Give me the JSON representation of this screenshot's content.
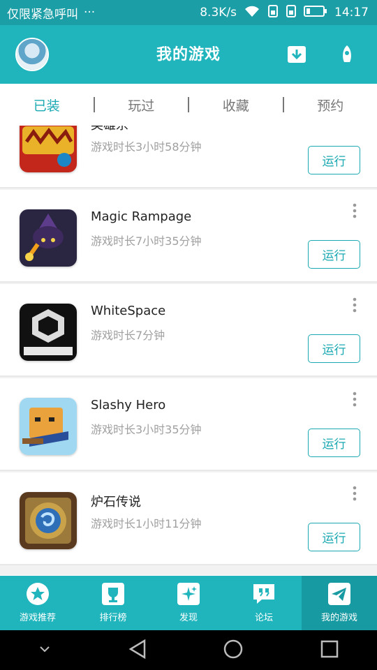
{
  "status_bar": {
    "carrier": "仅限紧急呼叫",
    "dots": "···",
    "speed": "8.3K/s",
    "time": "14:17"
  },
  "header": {
    "title": "我的游戏"
  },
  "tabs": [
    {
      "label": "已装",
      "active": true
    },
    {
      "label": "玩过",
      "active": false
    },
    {
      "label": "收藏",
      "active": false
    },
    {
      "label": "预约",
      "active": false
    }
  ],
  "games": [
    {
      "name": "英雄杀",
      "time": "游戏时长3小时58分钟",
      "button": "运行",
      "icon": "heroes-kill-icon"
    },
    {
      "name": "Magic Rampage",
      "time": "游戏时长7小时35分钟",
      "button": "运行",
      "icon": "magic-rampage-icon"
    },
    {
      "name": "WhiteSpace",
      "time": "游戏时长7分钟",
      "button": "运行",
      "icon": "whitespace-icon"
    },
    {
      "name": "Slashy Hero",
      "time": "游戏时长3小时35分钟",
      "button": "运行",
      "icon": "slashy-hero-icon"
    },
    {
      "name": "炉石传说",
      "time": "游戏时长1小时11分钟",
      "button": "运行",
      "icon": "hearthstone-icon"
    }
  ],
  "bottom_nav": [
    {
      "label": "游戏推荐",
      "icon": "star-icon",
      "active": false
    },
    {
      "label": "排行榜",
      "icon": "trophy-icon",
      "active": false
    },
    {
      "label": "发现",
      "icon": "sparkle-icon",
      "active": false
    },
    {
      "label": "论坛",
      "icon": "quote-icon",
      "active": false
    },
    {
      "label": "我的游戏",
      "icon": "paper-plane-icon",
      "active": true
    }
  ],
  "colors": {
    "primary": "#20b5bd",
    "accent": "#1aa9b2"
  }
}
